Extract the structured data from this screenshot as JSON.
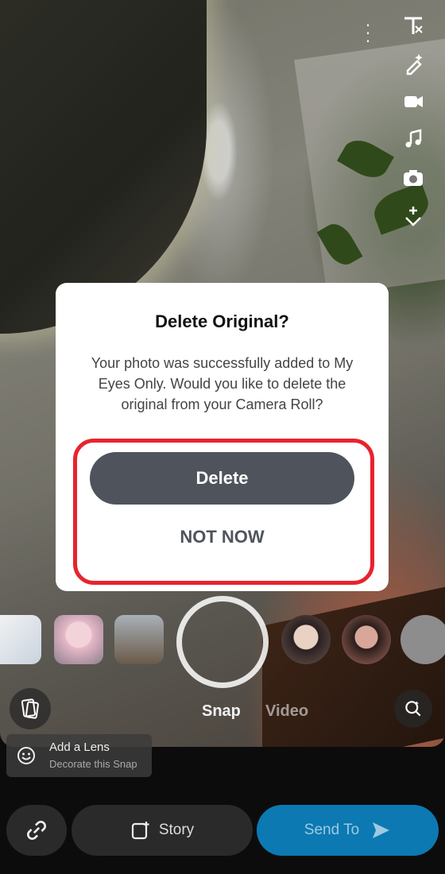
{
  "dialog": {
    "title": "Delete Original?",
    "message": "Your photo was successfully added to My Eyes Only. Would you like to delete the original from your Camera Roll?",
    "delete_label": "Delete",
    "not_now_label": "NOT NOW"
  },
  "camera": {
    "mode_snap": "Snap",
    "mode_video": "Video"
  },
  "add_lens": {
    "title": "Add a Lens",
    "subtitle": "Decorate this Snap"
  },
  "bottom_bar": {
    "story_label": "Story",
    "send_label": "Send To"
  },
  "colors": {
    "highlight": "#e8232e",
    "send_button": "#0c79b3",
    "delete_button": "#4f545c"
  },
  "icons": [
    "more-icon",
    "text-icon",
    "magic-pencil-icon",
    "video-clip-icon",
    "music-icon",
    "camera-swap-icon",
    "expand-chevron-icon",
    "gallery-icon",
    "lens-explore-icon",
    "add-lens-icon",
    "link-icon",
    "story-icon",
    "send-arrow-icon"
  ]
}
